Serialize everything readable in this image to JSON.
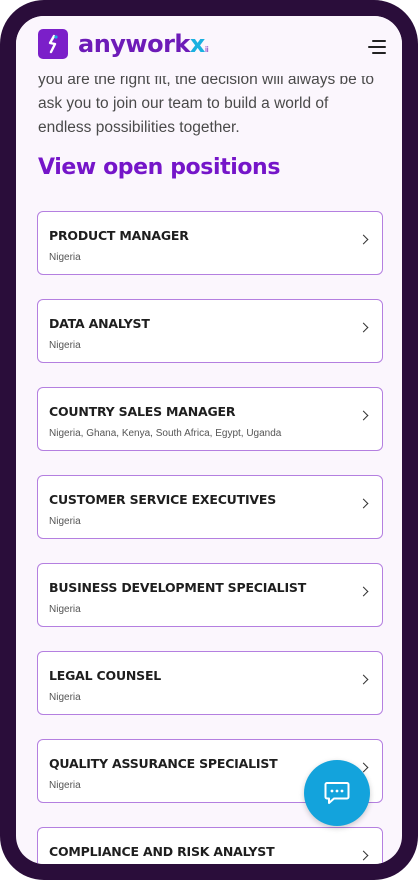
{
  "header": {
    "logo_text": "anywork",
    "logo_accent": "x",
    "logo_dot": "ii",
    "menu_icon": "hamburger-menu-icon"
  },
  "intro": {
    "text": "you are the right fit, the decision will always be to ask you to join our team to build a world of endless possibilities together."
  },
  "section": {
    "title": "View open positions"
  },
  "jobs": [
    {
      "title": "PRODUCT MANAGER",
      "location": "Nigeria"
    },
    {
      "title": "DATA ANALYST",
      "location": "Nigeria"
    },
    {
      "title": "COUNTRY SALES MANAGER",
      "location": "Nigeria, Ghana, Kenya, South Africa, Egypt, Uganda"
    },
    {
      "title": "CUSTOMER SERVICE EXECUTIVES",
      "location": "Nigeria"
    },
    {
      "title": "BUSINESS DEVELOPMENT SPECIALIST",
      "location": "Nigeria"
    },
    {
      "title": "LEGAL COUNSEL",
      "location": "Nigeria"
    },
    {
      "title": "QUALITY ASSURANCE SPECIALIST",
      "location": "Nigeria"
    },
    {
      "title": "COMPLIANCE AND RISK ANALYST",
      "location": ""
    }
  ],
  "chat": {
    "icon": "chat-bubble-icon"
  },
  "colors": {
    "brand_purple": "#7515c9",
    "accent_blue": "#13a3dc",
    "card_border": "#b47fe0",
    "device_frame": "#2a0d3a"
  }
}
